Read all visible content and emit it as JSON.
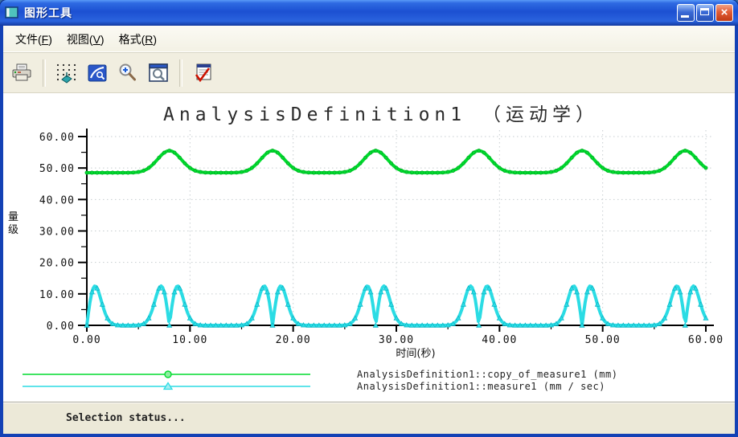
{
  "window": {
    "title": "图形工具",
    "icon": "graph-window-icon",
    "controls": {
      "minimize": "minimize",
      "maximize": "maximize",
      "close": "close"
    }
  },
  "menu": {
    "items": [
      {
        "pre": "文件(",
        "key": "F",
        "post": ")"
      },
      {
        "pre": "视图(",
        "key": "V",
        "post": ")"
      },
      {
        "pre": "格式(",
        "key": "R",
        "post": ")"
      }
    ]
  },
  "toolbar": {
    "buttons": [
      {
        "icon": "printer-icon",
        "name": "print"
      },
      {
        "icon": "grid-redraw-icon",
        "name": "redraw-graph"
      },
      {
        "icon": "zoom-window-icon",
        "name": "zoom-window"
      },
      {
        "icon": "zoom-in-icon",
        "name": "zoom-in"
      },
      {
        "icon": "zoom-refit-icon",
        "name": "refit-view"
      },
      {
        "icon": "export-excel-icon",
        "name": "export-graph"
      }
    ]
  },
  "status_bar": {
    "text": "Selection status..."
  },
  "chart_data": {
    "type": "line",
    "title": "AnalysisDefinition1 （运动学）",
    "xlabel": "时间(秒)",
    "ylabel": "量级",
    "xlim": [
      0,
      60
    ],
    "ylim": [
      0,
      60
    ],
    "x_ticks": [
      0,
      10,
      20,
      30,
      40,
      50,
      60
    ],
    "x_tick_labels": [
      "0.00",
      "10.00",
      "20.00",
      "30.00",
      "40.00",
      "50.00",
      "60.00"
    ],
    "y_ticks": [
      0,
      10,
      20,
      30,
      40,
      50,
      60
    ],
    "y_tick_labels": [
      "0.00",
      "10.00",
      "20.00",
      "30.00",
      "40.00",
      "50.00",
      "60.00"
    ],
    "grid": true,
    "legend_position": "bottom-left",
    "series": [
      {
        "name": "AnalysisDefinition1::copy_of_measure1 (mm)",
        "units": "mm",
        "color": "#00dc2e",
        "marker": "circle",
        "shape": "gaussian_bump",
        "baseline": 48.5,
        "peak": 55.5,
        "amplitude": 7,
        "sigma": 1.15,
        "event_times": [
          8,
          18,
          28,
          38,
          48,
          58
        ]
      },
      {
        "name": "AnalysisDefinition1::measure1 (mm / sec)",
        "units": "mm / sec",
        "color": "#2bdce4",
        "marker": "triangle",
        "shape": "abs_gaussian_derivative",
        "baseline": 0,
        "peak": 12.5,
        "sigma": 0.8,
        "event_times": [
          0,
          8,
          18,
          28,
          38,
          48,
          58
        ]
      }
    ]
  }
}
